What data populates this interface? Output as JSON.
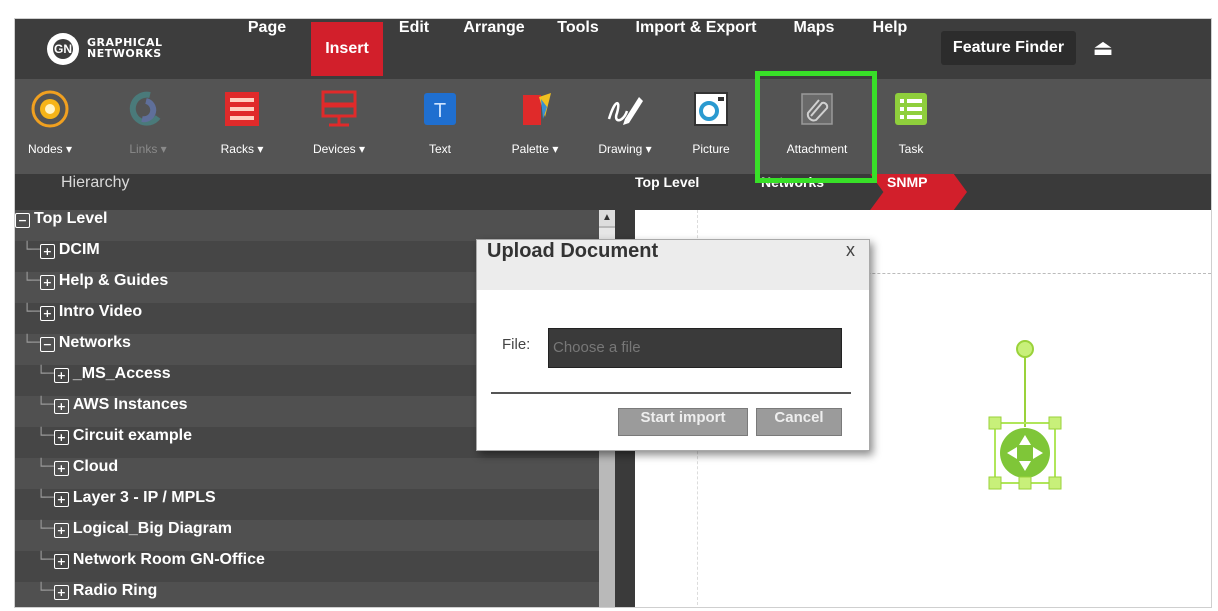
{
  "logo": {
    "line1": "GRAPHICAL",
    "line2": "NETWORKS",
    "mark": "GN"
  },
  "menu": [
    "Page",
    "Insert",
    "Edit",
    "Arrange",
    "Tools",
    "Import & Export",
    "Maps",
    "Help"
  ],
  "menu_active": "Insert",
  "feature_finder": "Feature Finder",
  "eject_glyph": "⏏",
  "ribbon": [
    {
      "label": "Nodes ▾",
      "icon": "nodes-icon"
    },
    {
      "label": "Links ▾",
      "icon": "links-icon",
      "disabled": true
    },
    {
      "label": "Racks ▾",
      "icon": "racks-icon"
    },
    {
      "label": "Devices ▾",
      "icon": "devices-icon"
    },
    {
      "label": "Text",
      "icon": "text-icon"
    },
    {
      "label": "Palette ▾",
      "icon": "palette-icon"
    },
    {
      "label": "Drawing ▾",
      "icon": "drawing-icon"
    },
    {
      "label": "Picture",
      "icon": "picture-icon"
    },
    {
      "label": "Attachment",
      "icon": "attachment-icon"
    },
    {
      "label": "Task",
      "icon": "task-icon"
    }
  ],
  "text_icon_letter": "T",
  "hierarchy_title": "Hierarchy",
  "breadcrumb": [
    "Top Level",
    "Networks",
    "SNMP"
  ],
  "tree": [
    {
      "label": "Top Level",
      "toggle": "−",
      "lines": ""
    },
    {
      "label": "DCIM",
      "toggle": "+",
      "lines": "└─"
    },
    {
      "label": "Help & Guides",
      "toggle": "+",
      "lines": "└─"
    },
    {
      "label": "Intro Video",
      "toggle": "+",
      "lines": "└─"
    },
    {
      "label": "Networks",
      "toggle": "−",
      "lines": "└─"
    },
    {
      "label": "_MS_Access",
      "toggle": "+",
      "lines": "  └─"
    },
    {
      "label": "AWS Instances",
      "toggle": "+",
      "lines": "  └─"
    },
    {
      "label": "Circuit example",
      "toggle": "+",
      "lines": "  └─"
    },
    {
      "label": "Cloud",
      "toggle": "+",
      "lines": "  └─"
    },
    {
      "label": "Layer 3 - IP / MPLS",
      "toggle": "+",
      "lines": "  └─"
    },
    {
      "label": "Logical_Big Diagram",
      "toggle": "+",
      "lines": "  └─"
    },
    {
      "label": "Network Room GN-Office",
      "toggle": "+",
      "lines": "  └─"
    },
    {
      "label": "Radio Ring",
      "toggle": "+",
      "lines": "  └─"
    }
  ],
  "dialog": {
    "title": "Upload Document",
    "close": "x",
    "file_label": "File:",
    "file_placeholder": "Choose a file",
    "start_button": "Start import",
    "cancel_button": "Cancel"
  },
  "colors": {
    "accent_red": "#d21f2b",
    "highlight_green": "#38e028",
    "node_green": "#8fd63a"
  }
}
